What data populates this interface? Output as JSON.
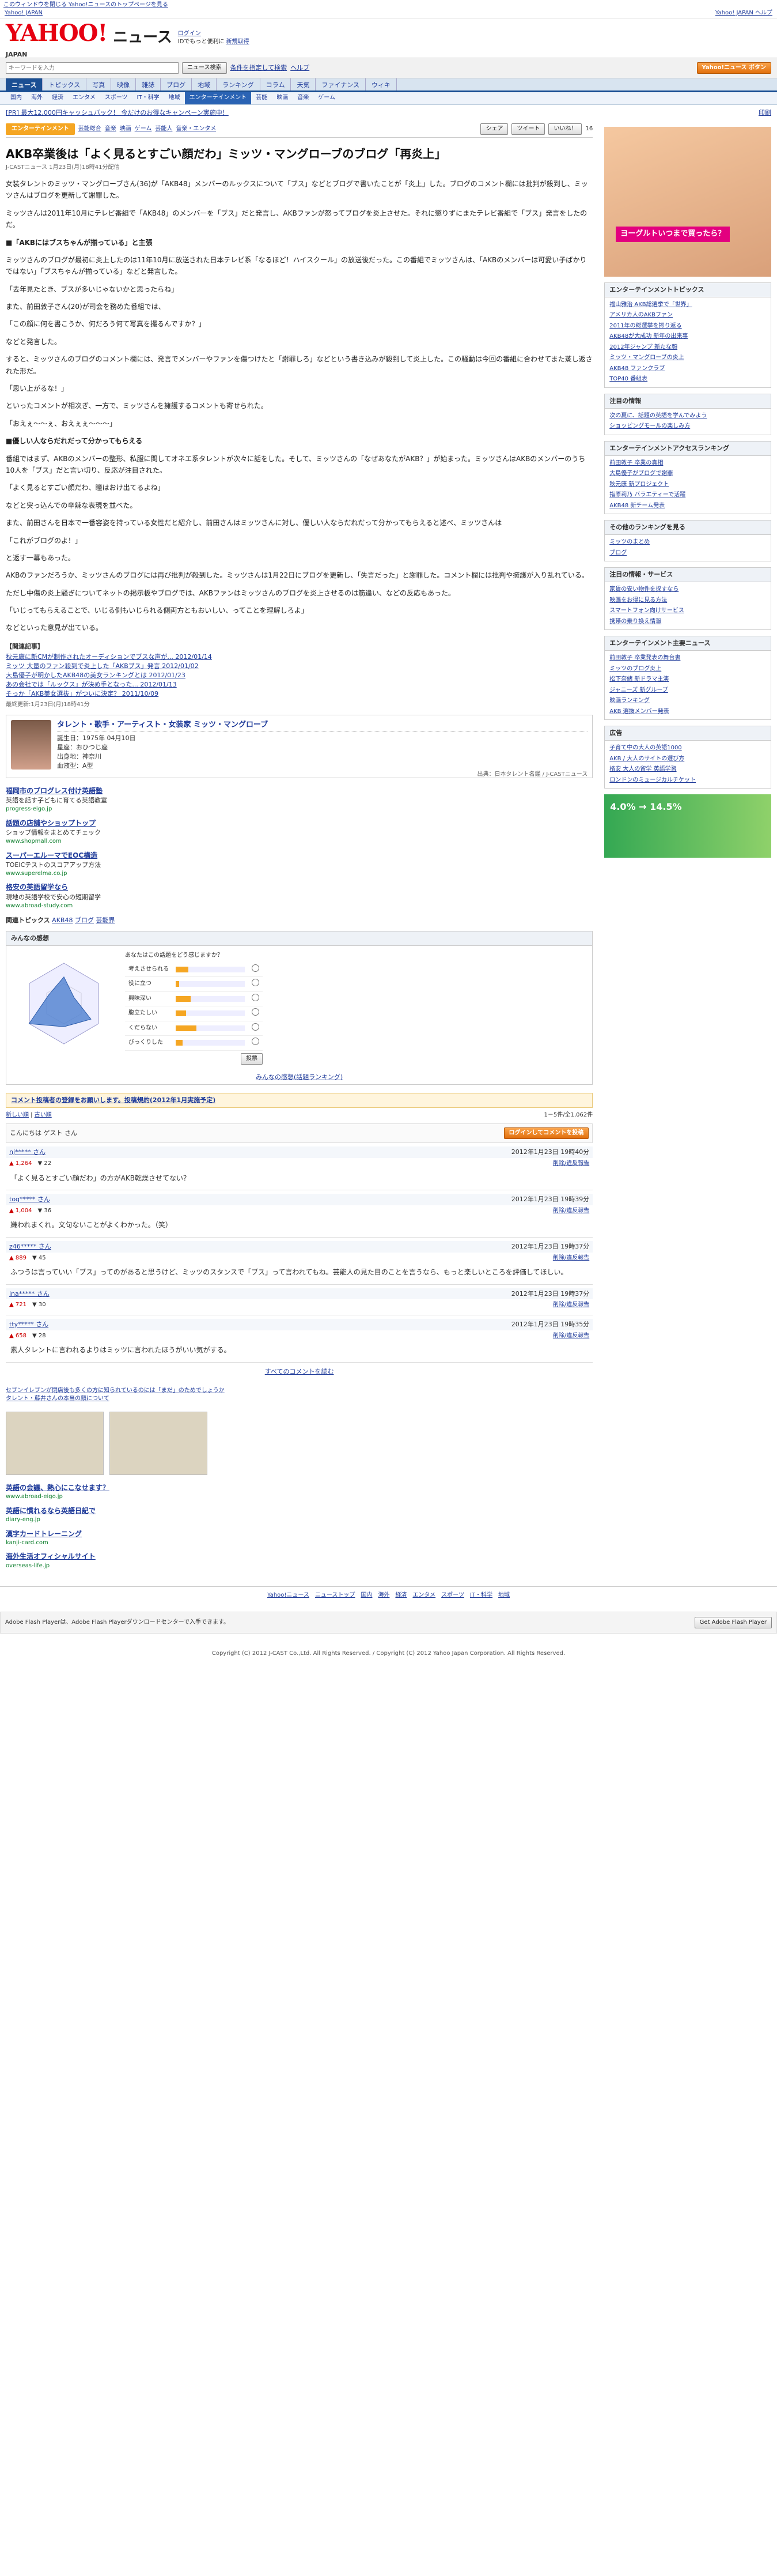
{
  "top_notice": "このウィンドウを閉じる  Yahoo!ニュースのトップページを見る",
  "topbar": {
    "left": "Yahoo! JAPAN",
    "right": "Yahoo! JAPAN  ヘルプ"
  },
  "header": {
    "logo": "YAHOO!",
    "logo_sub": "JAPAN",
    "service": "ニュース",
    "links": [
      "ログイン",
      "IDでもっと便利に",
      "新規取得"
    ]
  },
  "search": {
    "placeholder": "キーワードを入力",
    "button": "ニュース検索",
    "links": [
      "条件を指定して検索",
      "ヘルプ"
    ],
    "right_btn": "Yahoo!ニュース ボタン"
  },
  "gnav": [
    "ニュース",
    "トピックス",
    "写真",
    "映像",
    "雑誌",
    "ブログ",
    "地域",
    "ランキング",
    "コラム",
    "天気",
    "ファイナンス",
    "ウィキ"
  ],
  "gnav_on": 0,
  "snav": [
    "国内",
    "海外",
    "経済",
    "エンタメ",
    "スポーツ",
    "IT・科学",
    "地域",
    "エンターテインメント",
    "芸能",
    "映画",
    "音楽",
    "ゲーム"
  ],
  "snav_on": 7,
  "pr": {
    "left": "[PR] 最大12,000円キャッシュバック！ 今だけのお得なキャンペーン実施中！",
    "right": "印刷"
  },
  "cat": {
    "label": "エンターテインメント",
    "links": [
      "芸能総合",
      "音楽",
      "映画",
      "ゲーム",
      "芸能人",
      "音楽・エンタメ"
    ]
  },
  "social": {
    "share": "シェア",
    "tweet": "ツイート",
    "like": "いいね！",
    "count": "16"
  },
  "article": {
    "title": "AKB卒業後は「よく見るとすごい顔だわ」ミッツ・マングローブのブログ「再炎上」",
    "meta": "J-CASTニュース  1月23日(月)18時41分配信",
    "paras": [
      {
        "h": false,
        "t": "女装タレントのミッツ・マングローブさん(36)が「AKB48」メンバーのルックスについて「ブス」などとブログで書いたことが「炎上」した。ブログのコメント欄には批判が殺到し、ミッツさんはブログを更新して謝罪した。"
      },
      {
        "h": false,
        "t": "ミッツさんは2011年10月にテレビ番組で「AKB48」のメンバーを「ブス」だと発言し、AKBファンが怒ってブログを炎上させた。それに懲りずにまたテレビ番組で「ブス」発言をしたのだ。"
      },
      {
        "h": true,
        "t": "■「AKBにはブスちゃんが揃っている」と主張"
      },
      {
        "h": false,
        "t": "ミッツさんのブログが最初に炎上したのは11年10月に放送された日本テレビ系「なるほど！ハイスクール」の放送後だった。この番組でミッツさんは、「AKBのメンバーは可愛い子ばかりではない」「ブスちゃんが揃っている」などと発言した。"
      },
      {
        "h": false,
        "t": "「去年見たとき、ブスが多いじゃないかと思ったらね」"
      },
      {
        "h": false,
        "t": "また、前田敦子さん(20)が司会を務めた番組では、"
      },
      {
        "h": false,
        "t": "「この顔に何を書こうか、何だろう何て写真を撮るんですか？」"
      },
      {
        "h": false,
        "t": "などと発言した。"
      },
      {
        "h": false,
        "t": "すると、ミッツさんのブログのコメント欄には、発言でメンバーやファンを傷つけたと「謝罪しろ」などという書き込みが殺到して炎上した。この騒動は今回の番組に合わせてまた蒸し返された形だ。"
      },
      {
        "h": false,
        "t": "「思い上がるな！」"
      },
      {
        "h": false,
        "t": "といったコメントが相次ぎ、一方で、ミッツさんを擁護するコメントも寄せられた。"
      },
      {
        "h": false,
        "t": "「おえぇ〜〜ぇ、おえぇぇ〜〜〜」"
      },
      {
        "h": true,
        "t": "■優しい人ならだれだって分かってもらえる"
      },
      {
        "h": false,
        "t": "番組ではまず、AKBのメンバーの整形、私服に関してオネエ系タレントが次々に話をした。そして、ミッツさんの「なぜあなたがAKB？」が始まった。ミッツさんはAKBのメンバーのうち10人を「ブス」だと言い切り、反応が注目された。"
      },
      {
        "h": false,
        "t": "「よく見るとすごい顔だわ、瞳はおけ出てるよね」"
      },
      {
        "h": false,
        "t": "などと突っ込んでの辛辣な表現を並べた。"
      },
      {
        "h": false,
        "t": "また、前田さんを日本で一番容姿を持っている女性だと紹介し、前田さんはミッツさんに対し、優しい人ならだれだって分かってもらえると述べ、ミッツさんは"
      },
      {
        "h": false,
        "t": "「これがブログのよ！」"
      },
      {
        "h": false,
        "t": "と返す一幕もあった。"
      },
      {
        "h": false,
        "t": "AKBのファンだろうか、ミッツさんのブログには再び批判が殺到した。ミッツさんは1月22日にブログを更新し、「失言だった」と謝罪した。コメント欄には批判や擁護が入り乱れている。"
      },
      {
        "h": false,
        "t": "ただし中傷の炎上騒ぎについてネットの掲示板やブログでは、AKBファンはミッツさんのブログを炎上させるのは筋違い、などの反応もあった。"
      },
      {
        "h": false,
        "t": "「いじってもらえることで、いじる側もいじられる側両方ともおいしい、ってことを理解しろよ」"
      },
      {
        "h": false,
        "t": "などといった意見が出ている。"
      }
    ]
  },
  "related": {
    "h": "【関連記事】",
    "items": [
      "秋元康に新CMが制作されたオーディションでブスな声が... 2012/01/14",
      "ミッツ 大量のファン殺到で炎上した「AKBブス」発言 2012/01/02",
      "大島優子が明かしたAKB48の美女ランキングとは 2012/01/23",
      "あの会社では「ルックス」が決め手となった... 2012/01/13",
      "そっか「AKB美女選抜」がついに決定？ 2011/10/09"
    ],
    "date": "最終更新:1月23日(月)18時41分"
  },
  "profile": {
    "title": "タレント・歌手・アーティスト・女装家 ミッツ・マングローブ",
    "lines": [
      "誕生日：1975年 04月10日",
      "星座：おひつじ座",
      "出身地：神奈川",
      "血液型：A型"
    ],
    "source": "出典：日本タレント名鑑 / J-CASTニュース"
  },
  "ads": [
    {
      "t": "福岡市のプログレス付け英語塾",
      "d": "英語を話す子どもに育てる英語教室",
      "u": "progress-eigo.jp"
    },
    {
      "t": "話題の店舗やショップトップ",
      "d": "ショップ情報をまとめてチェック",
      "u": "www.shopmall.com"
    },
    {
      "t": "スーパーエルーマでEOC構造",
      "d": "TOEICテストのスコアアップ方法",
      "u": "www.superelma.co.jp"
    },
    {
      "t": "格安の英語留学なら",
      "d": "現地の英語学校で安心の短期留学",
      "u": "www.abroad-study.com"
    }
  ],
  "related_links": {
    "label": "関連トピックス",
    "items": [
      "AKB48",
      "ブログ",
      "芸能界"
    ]
  },
  "opinion": {
    "head": "みんなの感想",
    "q": "あなたはこの話題をどう感じますか？",
    "labels": [
      "考えさせられる",
      "役に立つ",
      "興味深い",
      "腹立たしい",
      "くだらない",
      "びっくりした"
    ],
    "values": [
      0.18,
      0.05,
      0.22,
      0.15,
      0.3,
      0.1
    ],
    "vote": "投票",
    "rank": "みんなの感想(話題ランキング)"
  },
  "comments": {
    "notice": "コメント投稿者の登録をお願いします。投稿規約(2012年1月実施予定)",
    "sort": [
      "新しい順",
      "古い順"
    ],
    "count": "1－5件/全1,062件",
    "guest": "こんにちは ゲスト さん",
    "login": "ログインしてコメントを投稿",
    "items": [
      {
        "user": "nj***** さん",
        "date": "2012年1月23日 19時40分",
        "like": "1,264",
        "bad": "22",
        "text": "「よく見るとすごい顔だわ」の方がAKB乾燥させてない？"
      },
      {
        "user": "tog***** さん",
        "date": "2012年1月23日 19時39分",
        "like": "1,004",
        "bad": "36",
        "text": "嫌われまくれ。文句ないことがよくわかった。（笑）"
      },
      {
        "user": "z46***** さん",
        "date": "2012年1月23日 19時37分",
        "like": "889",
        "bad": "45",
        "text": "ふつうは言っていい「ブス」ってのがあると思うけど、ミッツのスタンスで「ブス」って言われてもね。芸能人の見た目のことを言うなら、もっと楽しいところを評価してほしい。"
      },
      {
        "user": "ina***** さん",
        "date": "2012年1月23日 19時37分",
        "like": "721",
        "bad": "30",
        "text": ""
      },
      {
        "user": "tty***** さん",
        "date": "2012年1月23日 19時35分",
        "like": "658",
        "bad": "28",
        "text": "素人タレントに言われるよりはミッツに言われたほうがいい気がする。"
      }
    ],
    "all": "すべてのコメントを読む"
  },
  "bottom_links": [
    "セブンイレブンが閉店後も多くの方に知られているのには「まだ」のためでしょうか",
    "タレント・藤井さんの本当の顔について"
  ],
  "bottom_ads": [
    {
      "t": "英語の会議、熱心にこなせます？",
      "u": "www.abroad-eigo.jp"
    },
    {
      "t": "英語に慣れるなら英語日記で",
      "u": "diary-eng.jp"
    },
    {
      "t": "漢字カードトレーニング",
      "u": "kanji-card.com"
    },
    {
      "t": "海外生活オフィシャルサイト",
      "u": "overseas-life.jp"
    }
  ],
  "footer_nav": [
    "Yahoo!ニュース",
    "ニューストップ",
    "国内",
    "海外",
    "経済",
    "エンタメ",
    "スポーツ",
    "IT・科学",
    "地域"
  ],
  "flash": {
    "text": "Adobe Flash Playerは、Adobe Flash Playerダウンロードセンターで入手できます。",
    "btn": "Get Adobe Flash Player"
  },
  "copyright": "Copyright (C) 2012 J-CAST Co.,Ltd. All Rights Reserved. / Copyright (C) 2012 Yahoo Japan Corporation. All Rights Reserved.",
  "side": {
    "ad_caption": "ヨーグルトいつまで買ったら？",
    "sec1": {
      "h": "エンターテインメントトピックス",
      "items": [
        "福山雅治 AKB総選挙で「世界」",
        "アメリカ人のAKBファン",
        "2011年の総選挙を振り返る",
        "AKB48が大成功 新年の出来事",
        "2012年ジャンプ 新たな顔",
        "ミッツ・マングローブの炎上",
        "AKB48 ファンクラブ",
        "TOP40 番組表"
      ]
    },
    "sec2": {
      "h": "注目の情報",
      "items": [
        "次の夏に、話題の英語を学んでみよう",
        "ショッピングモールの楽しみ方"
      ]
    },
    "sec3": {
      "h": "エンターテインメントアクセスランキング",
      "items": [
        "前田敦子 卒業の真相",
        "大島優子がブログで謝罪",
        "秋元康 新プロジェクト",
        "指原莉乃 バラエティーで活躍",
        "AKB48 新チーム発表"
      ]
    },
    "sec4": {
      "h": "その他のランキングを見る",
      "items": [
        "ミッツのまとめ",
        "ブログ"
      ]
    },
    "sec5": {
      "h": "注目の情報・サービス",
      "items": [
        "家賃の安い物件を探すなら",
        "映画をお得に見る方法",
        "スマートフォン向けサービス",
        "携帯の乗り換え情報"
      ]
    },
    "sec6": {
      "h": "エンターテインメント主要ニュース",
      "items": [
        "前田敦子 卒業発表の舞台裏",
        "ミッツのブログ炎上",
        "松下奈緒 新ドラマ主演",
        "ジャニーズ 新グループ",
        "映画ランキング",
        "AKB 選抜メンバー発表"
      ]
    },
    "sec7": {
      "h": "広告",
      "items": [
        "子育て中の大人の英語1000",
        "AKB / 大人のサイトの選び方",
        "格安 大人の留学 英語学習",
        "ロンドンのミュージカルチケット"
      ]
    },
    "card_ad": "4.0% → 14.5%"
  }
}
